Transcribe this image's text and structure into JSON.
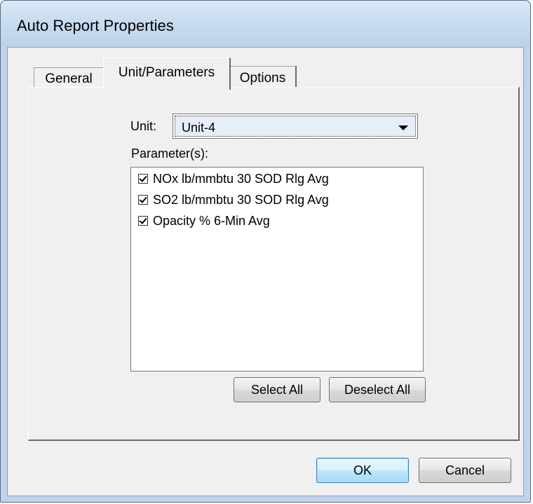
{
  "window": {
    "title": "Auto Report Properties"
  },
  "tabs": [
    {
      "label": "General",
      "active": false
    },
    {
      "label": "Unit/Parameters",
      "active": true
    },
    {
      "label": "Options",
      "active": false
    }
  ],
  "unit": {
    "label": "Unit:",
    "selected": "Unit-4"
  },
  "parameters": {
    "label": "Parameter(s):",
    "items": [
      {
        "label": "NOx lb/mmbtu 30 SOD Rlg Avg",
        "checked": true
      },
      {
        "label": "SO2 lb/mmbtu 30 SOD Rlg Avg",
        "checked": true
      },
      {
        "label": "Opacity % 6-Min Avg",
        "checked": true
      }
    ]
  },
  "buttons": {
    "select_all": "Select All",
    "deselect_all": "Deselect All",
    "ok": "OK",
    "cancel": "Cancel"
  },
  "colors": {
    "titlebar": "#c6d9ee",
    "dialog_face": "#f0f0f0",
    "default_button_border": "#3c7fb1"
  }
}
